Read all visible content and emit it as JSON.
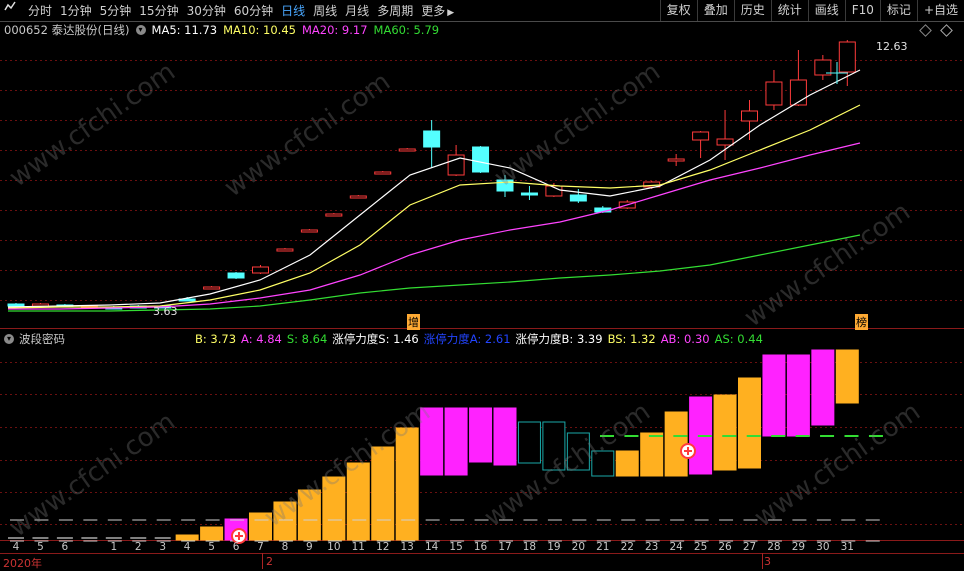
{
  "toolbar": {
    "tabs": [
      "分时",
      "1分钟",
      "5分钟",
      "15分钟",
      "30分钟",
      "60分钟",
      "日线",
      "周线",
      "月线",
      "多周期",
      "更多"
    ],
    "active_tab": "日线",
    "right_buttons": [
      "复权",
      "叠加",
      "历史",
      "统计",
      "画线",
      "F10",
      "标记",
      "+自选"
    ]
  },
  "stock": {
    "code_name": "000652 泰达股份(日线)",
    "ma5": "MA5: 11.73",
    "ma10": "MA10: 10.45",
    "ma20": "MA20: 9.17",
    "ma60": "MA60: 5.79",
    "high_label": "12.63",
    "low_label": "3.63",
    "marker_zeng": "增",
    "marker_bang": "榜"
  },
  "indicator": {
    "name": "波段密码",
    "b": "B: 3.73",
    "a": "A: 4.84",
    "s": "S: 8.64",
    "zts": "涨停力度S: 1.46",
    "zta": "涨停力度A: 2.61",
    "ztb": "涨停力度B: 3.39",
    "bs": "BS: 1.32",
    "ab": "AB: 0.30",
    "as": "AS: 0.44"
  },
  "watermark": "www.cfchi.com",
  "xaxis": {
    "day_labels": [
      "4",
      "5",
      "6",
      "",
      "1",
      "2",
      "3",
      "4",
      "5",
      "6",
      "7",
      "8",
      "9",
      "10",
      "11",
      "12",
      "13",
      "14",
      "15",
      "16",
      "17",
      "18",
      "19",
      "20",
      "21",
      "22",
      "23",
      "24",
      "25",
      "26",
      "27",
      "28",
      "29",
      "30",
      "31"
    ],
    "month_labels": [
      "2020年",
      "2",
      "3"
    ]
  },
  "colors": {
    "up": "#ff3b3b",
    "down": "#54ffff",
    "ma5": "#ffffff",
    "ma10": "#ffff66",
    "ma20": "#ff44ff",
    "ma60": "#33dd33",
    "active_tab": "#4aa8ff",
    "orange": "#ffb020",
    "magenta": "#ff22ff",
    "teal": "#1aa8a8"
  },
  "icons": [
    "chart-menu-icon",
    "circle-menu-icon",
    "diamond-icon",
    "crosshair-icon",
    "circle-plus-icon"
  ]
}
